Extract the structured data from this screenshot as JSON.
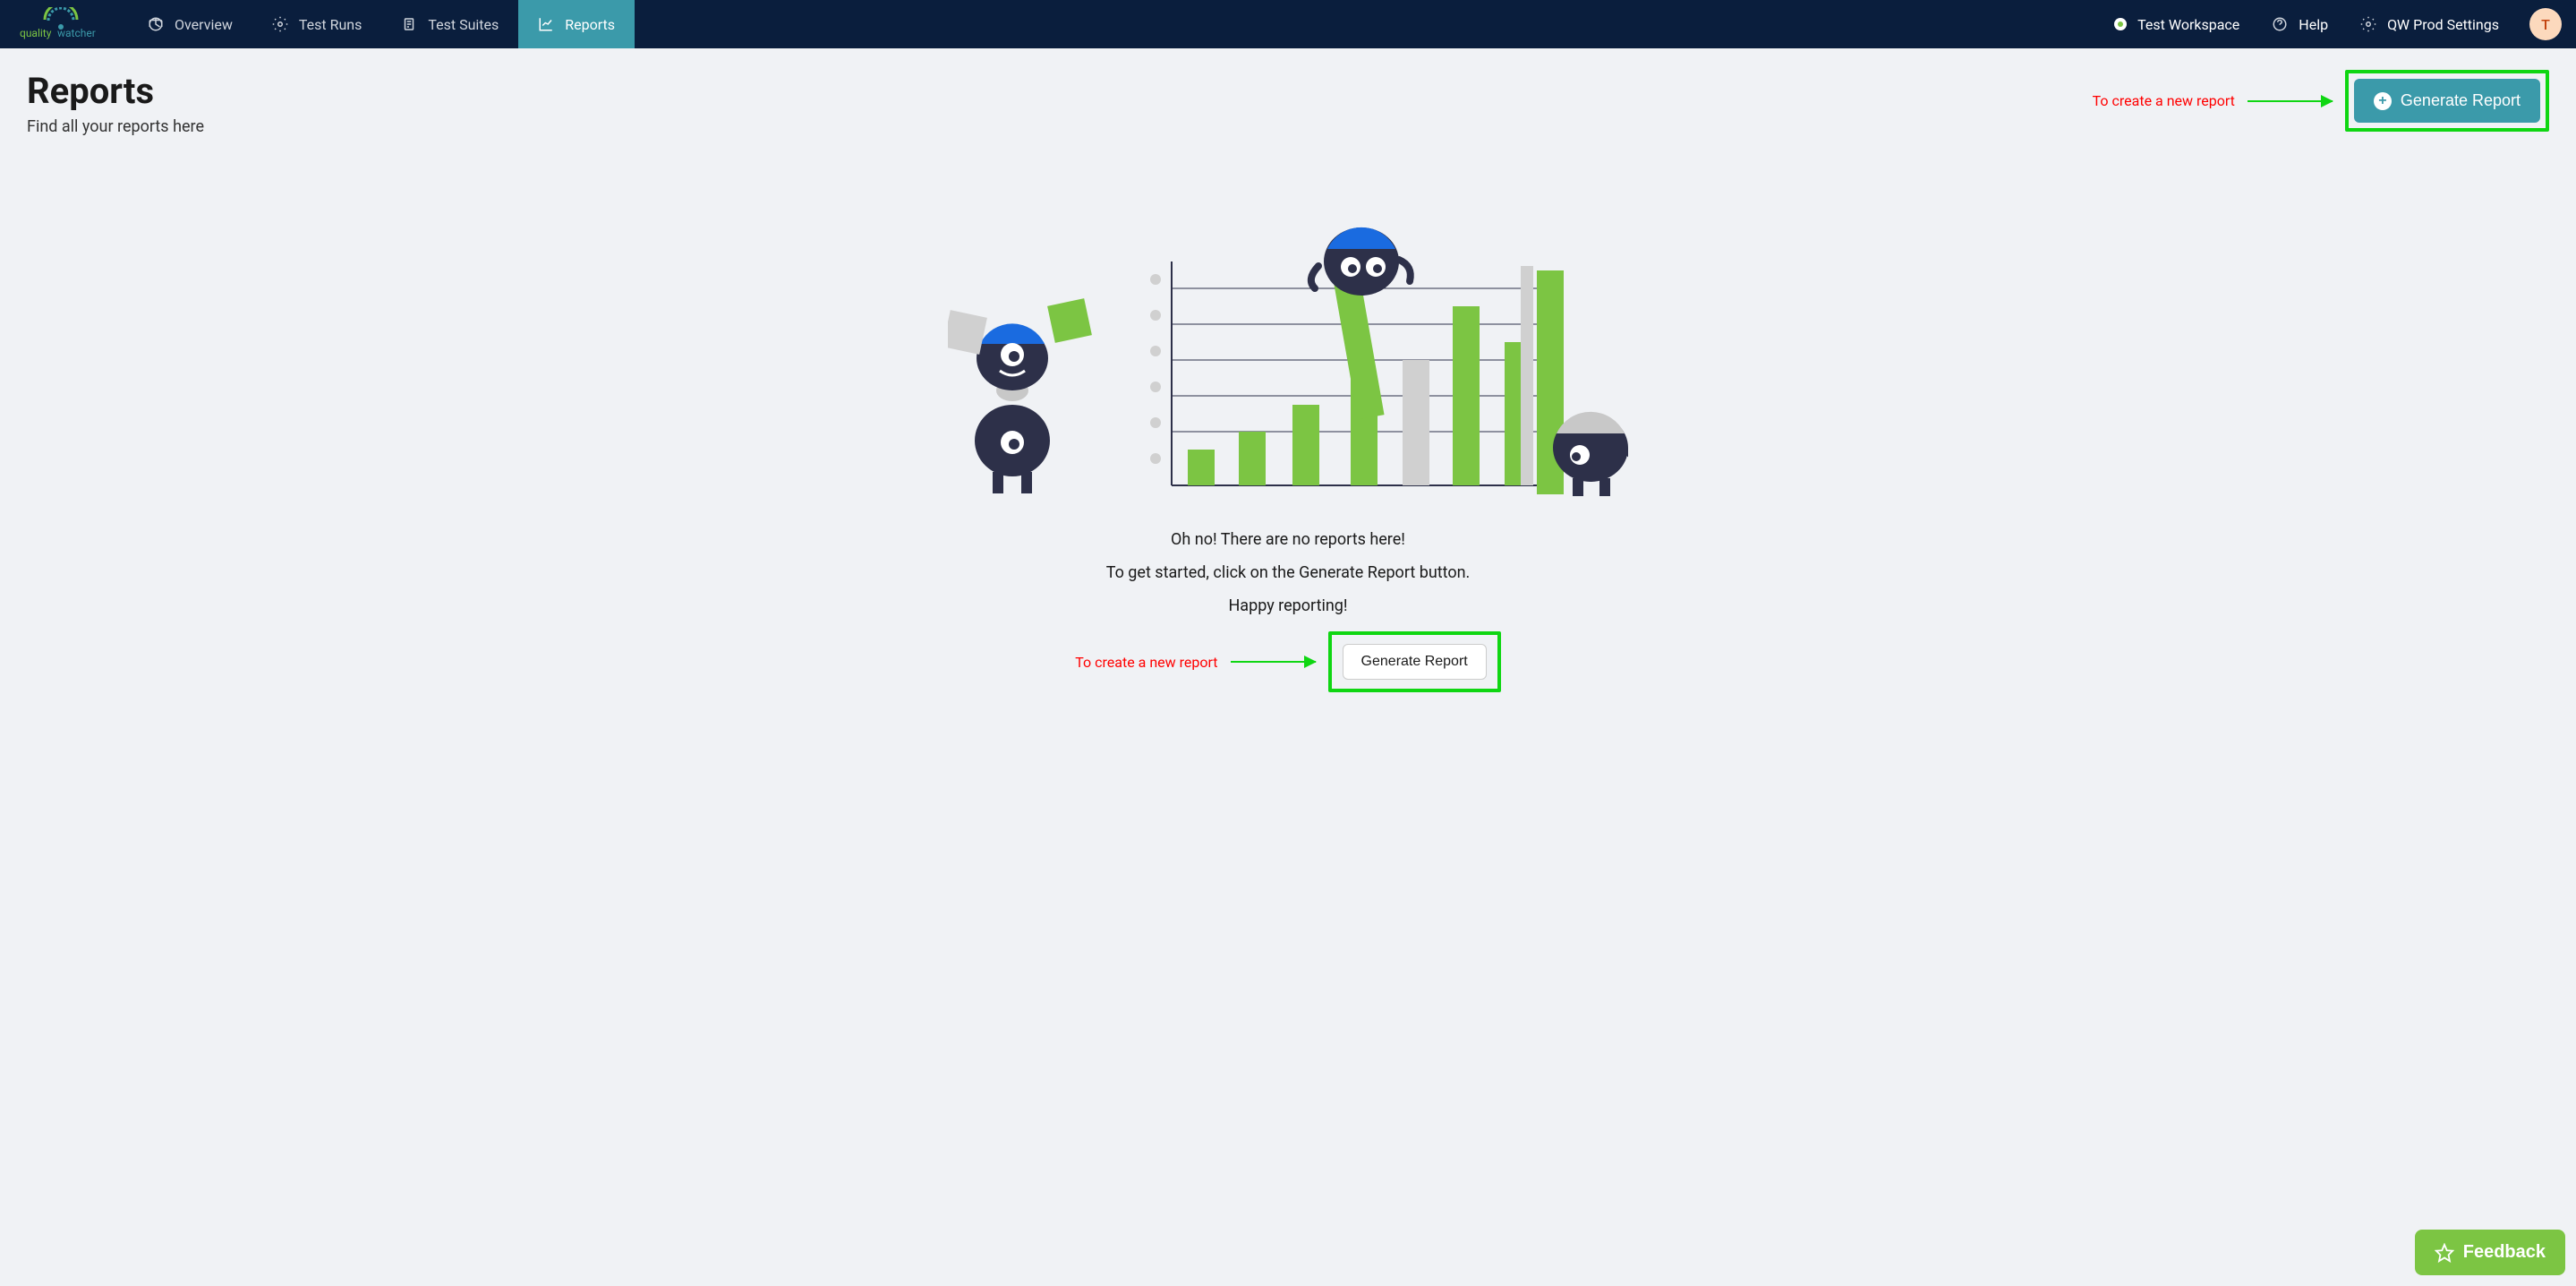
{
  "logo": {
    "quality": "quality",
    "watcher": "watcher"
  },
  "nav": {
    "overview": "Overview",
    "testRuns": "Test Runs",
    "testSuites": "Test Suites",
    "reports": "Reports"
  },
  "navRight": {
    "workspace": "Test Workspace",
    "help": "Help",
    "settings": "QW Prod Settings"
  },
  "avatar": "T",
  "page": {
    "title": "Reports",
    "subtitle": "Find all your reports here"
  },
  "annotations": {
    "topHint": "To create a new report",
    "bottomHint": "To create a new report"
  },
  "buttons": {
    "generateReportPrimary": "Generate Report",
    "generateReportSecondary": "Generate Report",
    "feedback": "Feedback"
  },
  "emptyState": {
    "line1": "Oh no! There are no reports here!",
    "line2": "To get started, click on the Generate Report button.",
    "line3": "Happy reporting!"
  }
}
